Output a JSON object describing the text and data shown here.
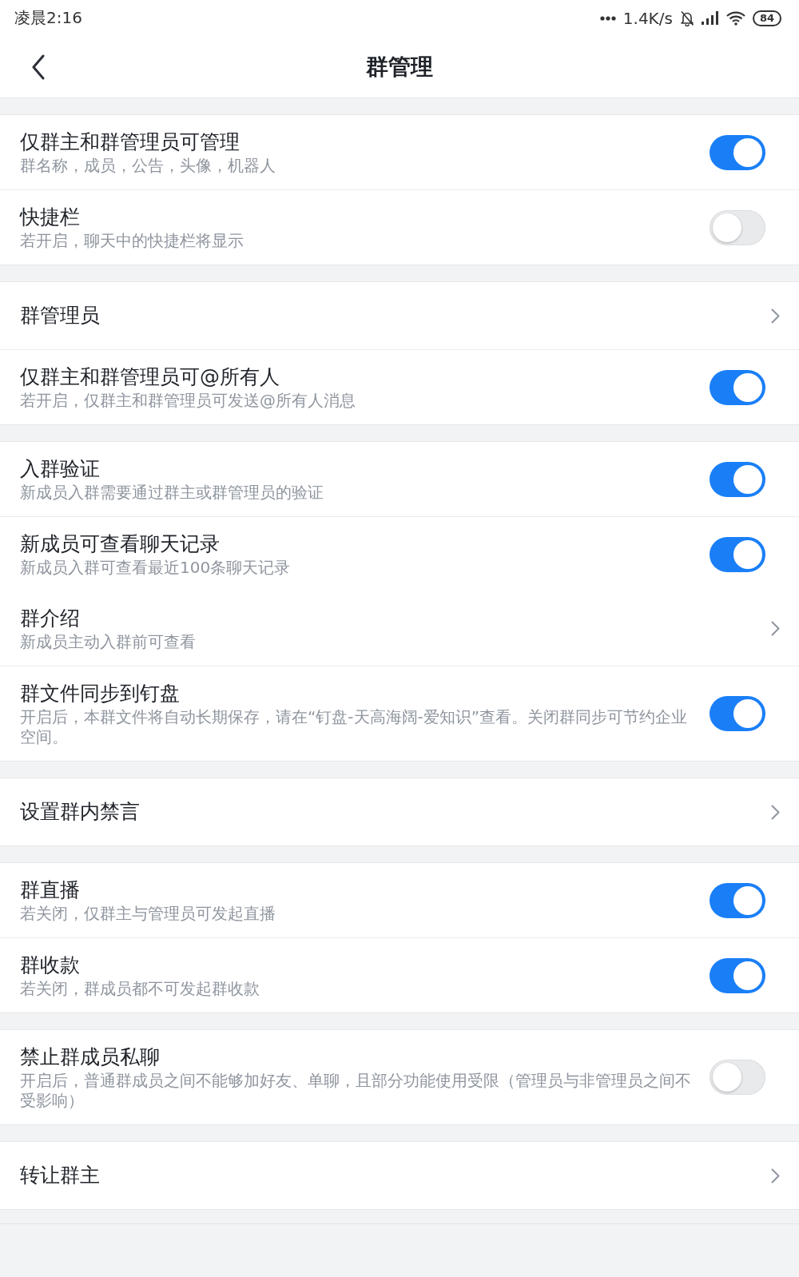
{
  "status_bar": {
    "time": "凌晨2:16",
    "network_speed": "1.4K/s",
    "battery": "84"
  },
  "header": {
    "title": "群管理"
  },
  "groups": [
    {
      "items": [
        {
          "kind": "toggle",
          "title": "仅群主和群管理员可管理",
          "subtitle": "群名称，成员，公告，头像，机器人",
          "on": true,
          "divider": true
        },
        {
          "kind": "toggle",
          "title": "快捷栏",
          "subtitle": "若开启，聊天中的快捷栏将显示",
          "on": false,
          "divider": false
        }
      ]
    },
    {
      "items": [
        {
          "kind": "link",
          "title": "群管理员",
          "divider": true
        },
        {
          "kind": "toggle",
          "title": "仅群主和群管理员可@所有人",
          "subtitle": "若开启，仅群主和群管理员可发送@所有人消息",
          "on": true,
          "divider": false
        }
      ]
    },
    {
      "items": [
        {
          "kind": "toggle",
          "title": "入群验证",
          "subtitle": "新成员入群需要通过群主或群管理员的验证",
          "on": true,
          "divider": true
        },
        {
          "kind": "toggle",
          "title": "新成员可查看聊天记录",
          "subtitle": "新成员入群可查看最近100条聊天记录",
          "on": true,
          "divider": false
        },
        {
          "kind": "link",
          "title": "群介绍",
          "subtitle": "新成员主动入群前可查看",
          "divider": true
        },
        {
          "kind": "toggle",
          "title": "群文件同步到钉盘",
          "subtitle": "开启后，本群文件将自动长期保存，请在“钉盘-天高海阔-爱知识”查看。关闭群同步可节约企业空间。",
          "on": true,
          "divider": false
        }
      ]
    },
    {
      "items": [
        {
          "kind": "link",
          "title": "设置群内禁言",
          "divider": false
        }
      ]
    },
    {
      "items": [
        {
          "kind": "toggle",
          "title": "群直播",
          "subtitle": "若关闭，仅群主与管理员可发起直播",
          "on": true,
          "divider": true
        },
        {
          "kind": "toggle",
          "title": "群收款",
          "subtitle": "若关闭，群成员都不可发起群收款",
          "on": true,
          "divider": false
        }
      ]
    },
    {
      "items": [
        {
          "kind": "toggle",
          "title": "禁止群成员私聊",
          "subtitle": "开启后，普通群成员之间不能够加好友、单聊，且部分功能使用受限（管理员与非管理员之间不受影响）",
          "on": false,
          "divider": false
        }
      ]
    },
    {
      "items": [
        {
          "kind": "link",
          "title": "转让群主",
          "divider": false
        }
      ]
    }
  ]
}
